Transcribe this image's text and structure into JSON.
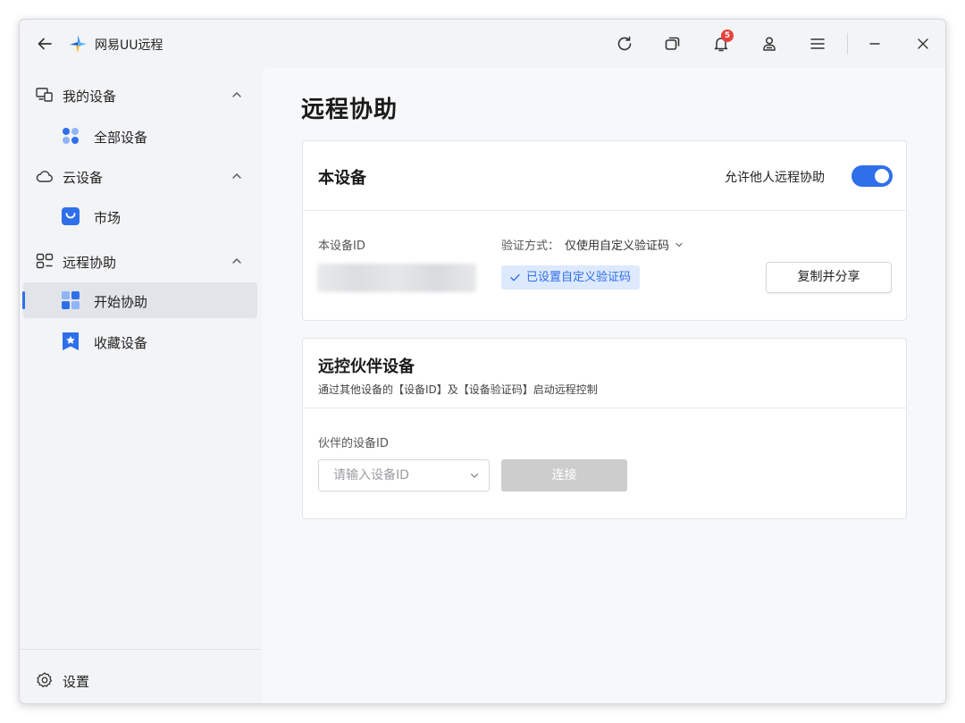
{
  "app": {
    "title": "网易UU远程",
    "notification_count": "5",
    "accent_color": "#2f6fea"
  },
  "titlebar_icons": [
    "back-arrow-icon",
    "refresh-icon",
    "multi-window-icon",
    "bell-icon",
    "user-icon",
    "menu-icon",
    "minimize-icon",
    "close-icon"
  ],
  "sidebar": {
    "groups": [
      {
        "label": "我的设备",
        "icon": "devices-icon",
        "items": [
          {
            "label": "全部设备",
            "icon": "grid-dots-icon"
          }
        ]
      },
      {
        "label": "云设备",
        "icon": "cloud-icon",
        "items": [
          {
            "label": "市场",
            "icon": "shopping-bag-icon"
          }
        ]
      },
      {
        "label": "远程协助",
        "icon": "remote-assist-icon",
        "items": [
          {
            "label": "开始协助",
            "icon": "start-assist-icon",
            "active": true
          },
          {
            "label": "收藏设备",
            "icon": "bookmark-star-icon"
          }
        ]
      }
    ],
    "settings_label": "设置"
  },
  "main": {
    "title": "远程协助",
    "this_device": {
      "title": "本设备",
      "allow_label": "允许他人远程协助",
      "allow_enabled": true,
      "id_label": "本设备ID",
      "verify_label": "验证方式：",
      "verify_value": "仅使用自定义验证码",
      "verify_status": "已设置自定义验证码",
      "copy_share_button": "复制并分享"
    },
    "partner": {
      "title": "远控伙伴设备",
      "subtitle": "通过其他设备的【设备ID】及【设备验证码】启动远程控制",
      "id_label": "伙伴的设备ID",
      "id_placeholder": "请输入设备ID",
      "connect_button": "连接"
    }
  }
}
